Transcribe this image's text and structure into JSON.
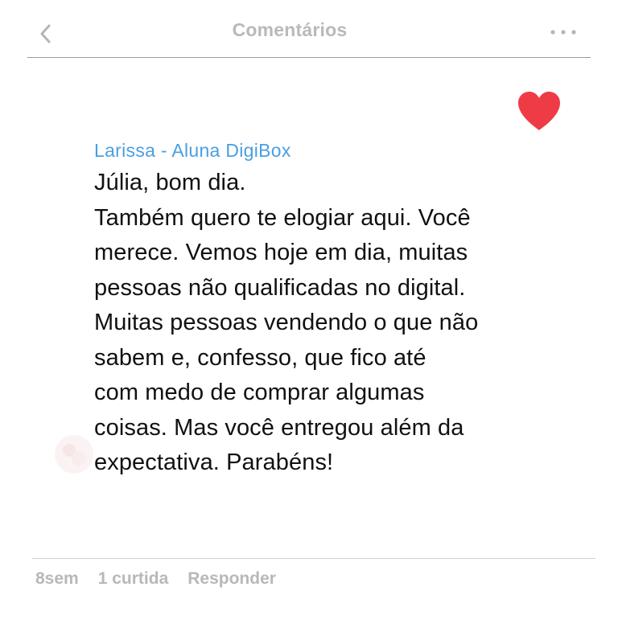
{
  "header": {
    "title": "Comentários",
    "back_icon": "chevron-left-icon",
    "more_icon": "more-horizontal-icon"
  },
  "comment": {
    "author": "Larissa - Aluna DigiBox",
    "lines": [
      "Júlia, bom dia.",
      "Também quero te elogiar aqui. Você",
      "merece. Vemos hoje em dia, muitas",
      "pessoas não qualificadas no digital.",
      "Muitas pessoas vendendo o que não",
      "sabem e, confesso, que fico até",
      "com medo de comprar algumas",
      "coisas. Mas você entregou além da",
      "expectativa. Parabéns!"
    ],
    "liked": true,
    "like_icon": "heart-icon"
  },
  "footer": {
    "time": "8sem",
    "likes": "1 curtida",
    "reply_label": "Responder"
  },
  "colors": {
    "author": "#4a9fe0",
    "heart": "#ef3b46",
    "muted": "#b8b8b8",
    "text": "#111111"
  }
}
